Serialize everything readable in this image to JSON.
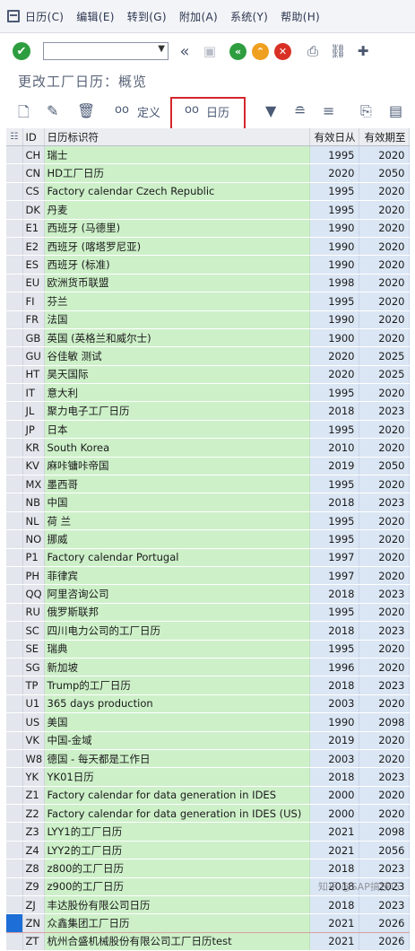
{
  "menu": [
    "日历(C)",
    "编辑(E)",
    "转到(G)",
    "附加(A)",
    "系统(Y)",
    "帮助(H)"
  ],
  "toolbar": {
    "command_value": ""
  },
  "title": "更改工厂日历：概览",
  "app_toolbar": {
    "define_label": "定义",
    "calendar_label": "日历"
  },
  "table": {
    "headers": {
      "id": "ID",
      "name": "日历标识符",
      "from": "有效日从",
      "to": "有效期至"
    },
    "rows": [
      {
        "id": "CH",
        "name": "瑞士",
        "from": "1995",
        "to": "2020"
      },
      {
        "id": "CN",
        "name": "HD工厂日历",
        "from": "2020",
        "to": "2050"
      },
      {
        "id": "CS",
        "name": "Factory calendar Czech Republic",
        "from": "1995",
        "to": "2020"
      },
      {
        "id": "DK",
        "name": "丹麦",
        "from": "1995",
        "to": "2020"
      },
      {
        "id": "E1",
        "name": "西班牙 (马德里)",
        "from": "1990",
        "to": "2020"
      },
      {
        "id": "E2",
        "name": "西班牙 (喀塔罗尼亚)",
        "from": "1990",
        "to": "2020"
      },
      {
        "id": "ES",
        "name": "西班牙 (标准)",
        "from": "1990",
        "to": "2020"
      },
      {
        "id": "EU",
        "name": "欧洲货币联盟",
        "from": "1998",
        "to": "2020"
      },
      {
        "id": "FI",
        "name": "芬兰",
        "from": "1995",
        "to": "2020"
      },
      {
        "id": "FR",
        "name": "法国",
        "from": "1990",
        "to": "2020"
      },
      {
        "id": "GB",
        "name": "英国 (英格兰和威尔士)",
        "from": "1900",
        "to": "2020"
      },
      {
        "id": "GU",
        "name": "谷佳敏 测试",
        "from": "2020",
        "to": "2025"
      },
      {
        "id": "HT",
        "name": "昊天国际",
        "from": "2020",
        "to": "2025"
      },
      {
        "id": "IT",
        "name": "意大利",
        "from": "1995",
        "to": "2020"
      },
      {
        "id": "JL",
        "name": "聚力电子工厂日历",
        "from": "2018",
        "to": "2023"
      },
      {
        "id": "JP",
        "name": "日本",
        "from": "1995",
        "to": "2020"
      },
      {
        "id": "KR",
        "name": "South Korea",
        "from": "2010",
        "to": "2020"
      },
      {
        "id": "KV",
        "name": "麻咔镛咔帝国",
        "from": "2019",
        "to": "2050"
      },
      {
        "id": "MX",
        "name": "墨西哥",
        "from": "1995",
        "to": "2020"
      },
      {
        "id": "NB",
        "name": "中国",
        "from": "2018",
        "to": "2023"
      },
      {
        "id": "NL",
        "name": "荷 兰",
        "from": "1995",
        "to": "2020"
      },
      {
        "id": "NO",
        "name": "挪威",
        "from": "1995",
        "to": "2020"
      },
      {
        "id": "P1",
        "name": "Factory calendar Portugal",
        "from": "1997",
        "to": "2020"
      },
      {
        "id": "PH",
        "name": "菲律宾",
        "from": "1997",
        "to": "2020"
      },
      {
        "id": "QQ",
        "name": "阿里咨询公司",
        "from": "2018",
        "to": "2023"
      },
      {
        "id": "RU",
        "name": "俄罗斯联邦",
        "from": "1995",
        "to": "2020"
      },
      {
        "id": "SC",
        "name": "四川电力公司的工厂日历",
        "from": "2018",
        "to": "2023"
      },
      {
        "id": "SE",
        "name": "瑞典",
        "from": "1995",
        "to": "2020"
      },
      {
        "id": "SG",
        "name": "新加坡",
        "from": "1996",
        "to": "2020"
      },
      {
        "id": "TP",
        "name": "Trump的工厂日历",
        "from": "2018",
        "to": "2023"
      },
      {
        "id": "U1",
        "name": "365 days production",
        "from": "2003",
        "to": "2020"
      },
      {
        "id": "US",
        "name": "美国",
        "from": "1990",
        "to": "2098"
      },
      {
        "id": "VK",
        "name": "中国-金域",
        "from": "2019",
        "to": "2020"
      },
      {
        "id": "W8",
        "name": "德国 - 每天都是工作日",
        "from": "2003",
        "to": "2020"
      },
      {
        "id": "YK",
        "name": "YK01日历",
        "from": "2018",
        "to": "2023"
      },
      {
        "id": "Z1",
        "name": "Factory calendar for data generation in IDES",
        "from": "2000",
        "to": "2020"
      },
      {
        "id": "Z2",
        "name": "Factory calendar for data generation in IDES (US)",
        "from": "2000",
        "to": "2020"
      },
      {
        "id": "Z3",
        "name": "LYY1的工厂日历",
        "from": "2021",
        "to": "2098"
      },
      {
        "id": "Z4",
        "name": "LYY2的工厂日历",
        "from": "2021",
        "to": "2056"
      },
      {
        "id": "Z8",
        "name": "z800的工厂日历",
        "from": "2018",
        "to": "2023"
      },
      {
        "id": "Z9",
        "name": "z900的工厂日历",
        "from": "2018",
        "to": "2023"
      },
      {
        "id": "ZJ",
        "name": "丰达股份有限公司日历",
        "from": "2018",
        "to": "2023"
      },
      {
        "id": "ZN",
        "name": "众鑫集团工厂日历",
        "from": "2021",
        "to": "2026",
        "active": true
      },
      {
        "id": "ZT",
        "name": "杭州合盛机械股份有限公司工厂日历test",
        "from": "2021",
        "to": "2026"
      }
    ]
  },
  "watermark": "知乎 @SAP搞技巧"
}
